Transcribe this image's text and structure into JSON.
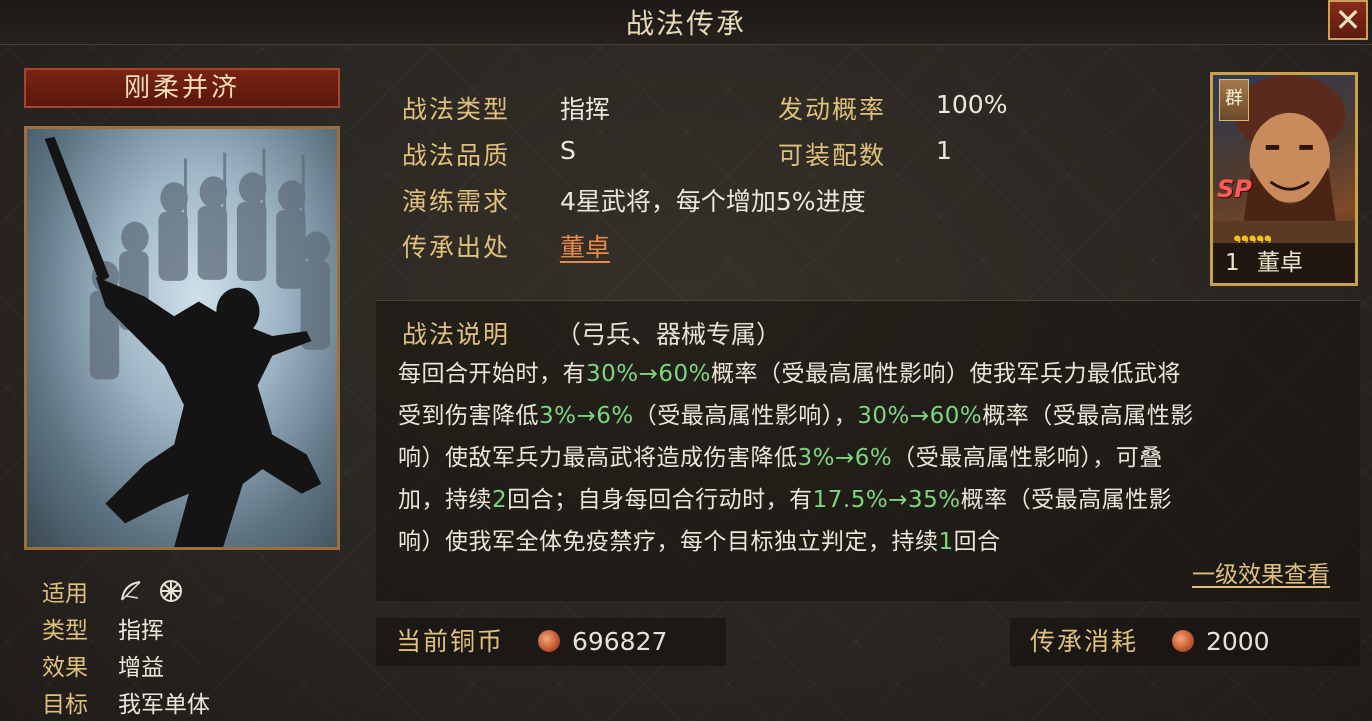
{
  "window": {
    "title": "战法传承",
    "close_label": "✕"
  },
  "skill": {
    "name": "刚柔并济",
    "meta": [
      {
        "key": "适用",
        "value": ""
      },
      {
        "key": "类型",
        "value": "指挥"
      },
      {
        "key": "效果",
        "value": "增益"
      },
      {
        "key": "目标",
        "value": "我军单体"
      }
    ],
    "applicable_icons": [
      "bow-icon",
      "siege-wheel-icon"
    ]
  },
  "info": {
    "type_label": "战法类型",
    "type_value": "指挥",
    "rate_label": "发动概率",
    "rate_value": "100%",
    "quality_label": "战法品质",
    "quality_value": "S",
    "slots_label": "可装配数",
    "slots_value": "1",
    "req_label": "演练需求",
    "req_value": "4星武将，每个增加5%进度",
    "source_label": "传承出处",
    "source_value": "董卓"
  },
  "general": {
    "faction": "群",
    "tag": "SP",
    "stars": "❟❟❟❟❟",
    "level": "1",
    "name": "董卓"
  },
  "description": {
    "title": "战法说明",
    "subtitle": "（弓兵、器械专属）",
    "lines": {
      "l1a": "每回合开始时，有",
      "l1g": "30%→60%",
      "l1b": "概率（受最高属性影响）使我军兵力最低武将",
      "l2a": "受到伤害降低",
      "l2g": "3%→6%",
      "l2b": "（受最高属性影响），",
      "l2g2": "30%→60%",
      "l2c": "概率（受最高属性影",
      "l3a": "响）使敌军兵力最高武将造成伤害降低",
      "l3g": "3%→6%",
      "l3b": "（受最高属性影响），可叠",
      "l4a": "加，持续",
      "l4g": "2",
      "l4b": "回合；自身每回合行动时，有",
      "l4g2": "17.5%→35%",
      "l4c": "概率（受最高属性影",
      "l5a": "响）使我军全体免疫禁疗，每个目标独立判定，持续",
      "l5g": "1",
      "l5b": "回合"
    },
    "view_link": "一级效果查看"
  },
  "currency": {
    "current_label": "当前铜币",
    "current_value": "696827",
    "cost_label": "传承消耗",
    "cost_value": "2000"
  },
  "colors": {
    "accent": "#e0c07a",
    "highlight": "#7ed57e",
    "link": "#e8894a"
  }
}
